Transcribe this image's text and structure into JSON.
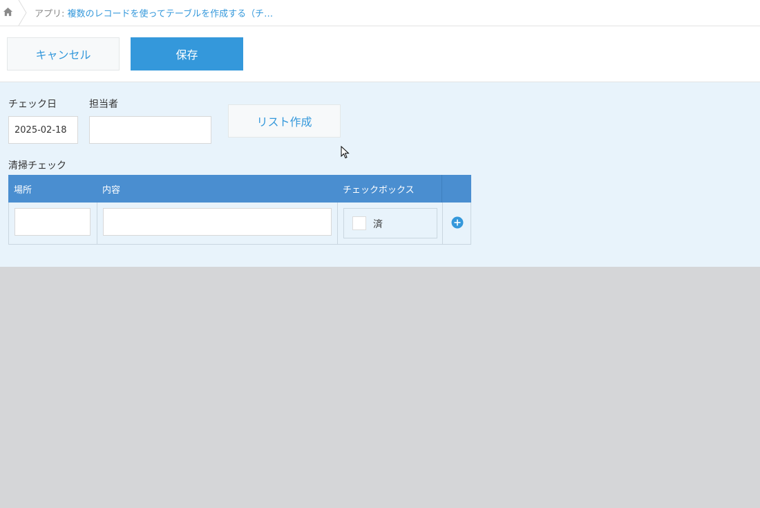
{
  "breadcrumb": {
    "home_icon": "home-icon",
    "prefix": "アプリ:",
    "app_name": "複数のレコードを使ってテーブルを作成する（チ…"
  },
  "actions": {
    "cancel_label": "キャンセル",
    "save_label": "保存"
  },
  "form": {
    "check_date": {
      "label": "チェック日",
      "value": "2025-02-18"
    },
    "assignee": {
      "label": "担当者",
      "value": ""
    },
    "list_button_label": "リスト作成"
  },
  "subtable": {
    "label": "清掃チェック",
    "columns": [
      "場所",
      "内容",
      "チェックボックス"
    ],
    "rows": [
      {
        "place": "",
        "content": "",
        "checkbox_label": "済",
        "checked": false
      }
    ],
    "add_icon": "add-row-icon"
  },
  "colors": {
    "accent": "#3498db",
    "table_header": "#4a8ed0",
    "form_background": "#e8f3fb",
    "page_background": "#d5d6d8"
  }
}
